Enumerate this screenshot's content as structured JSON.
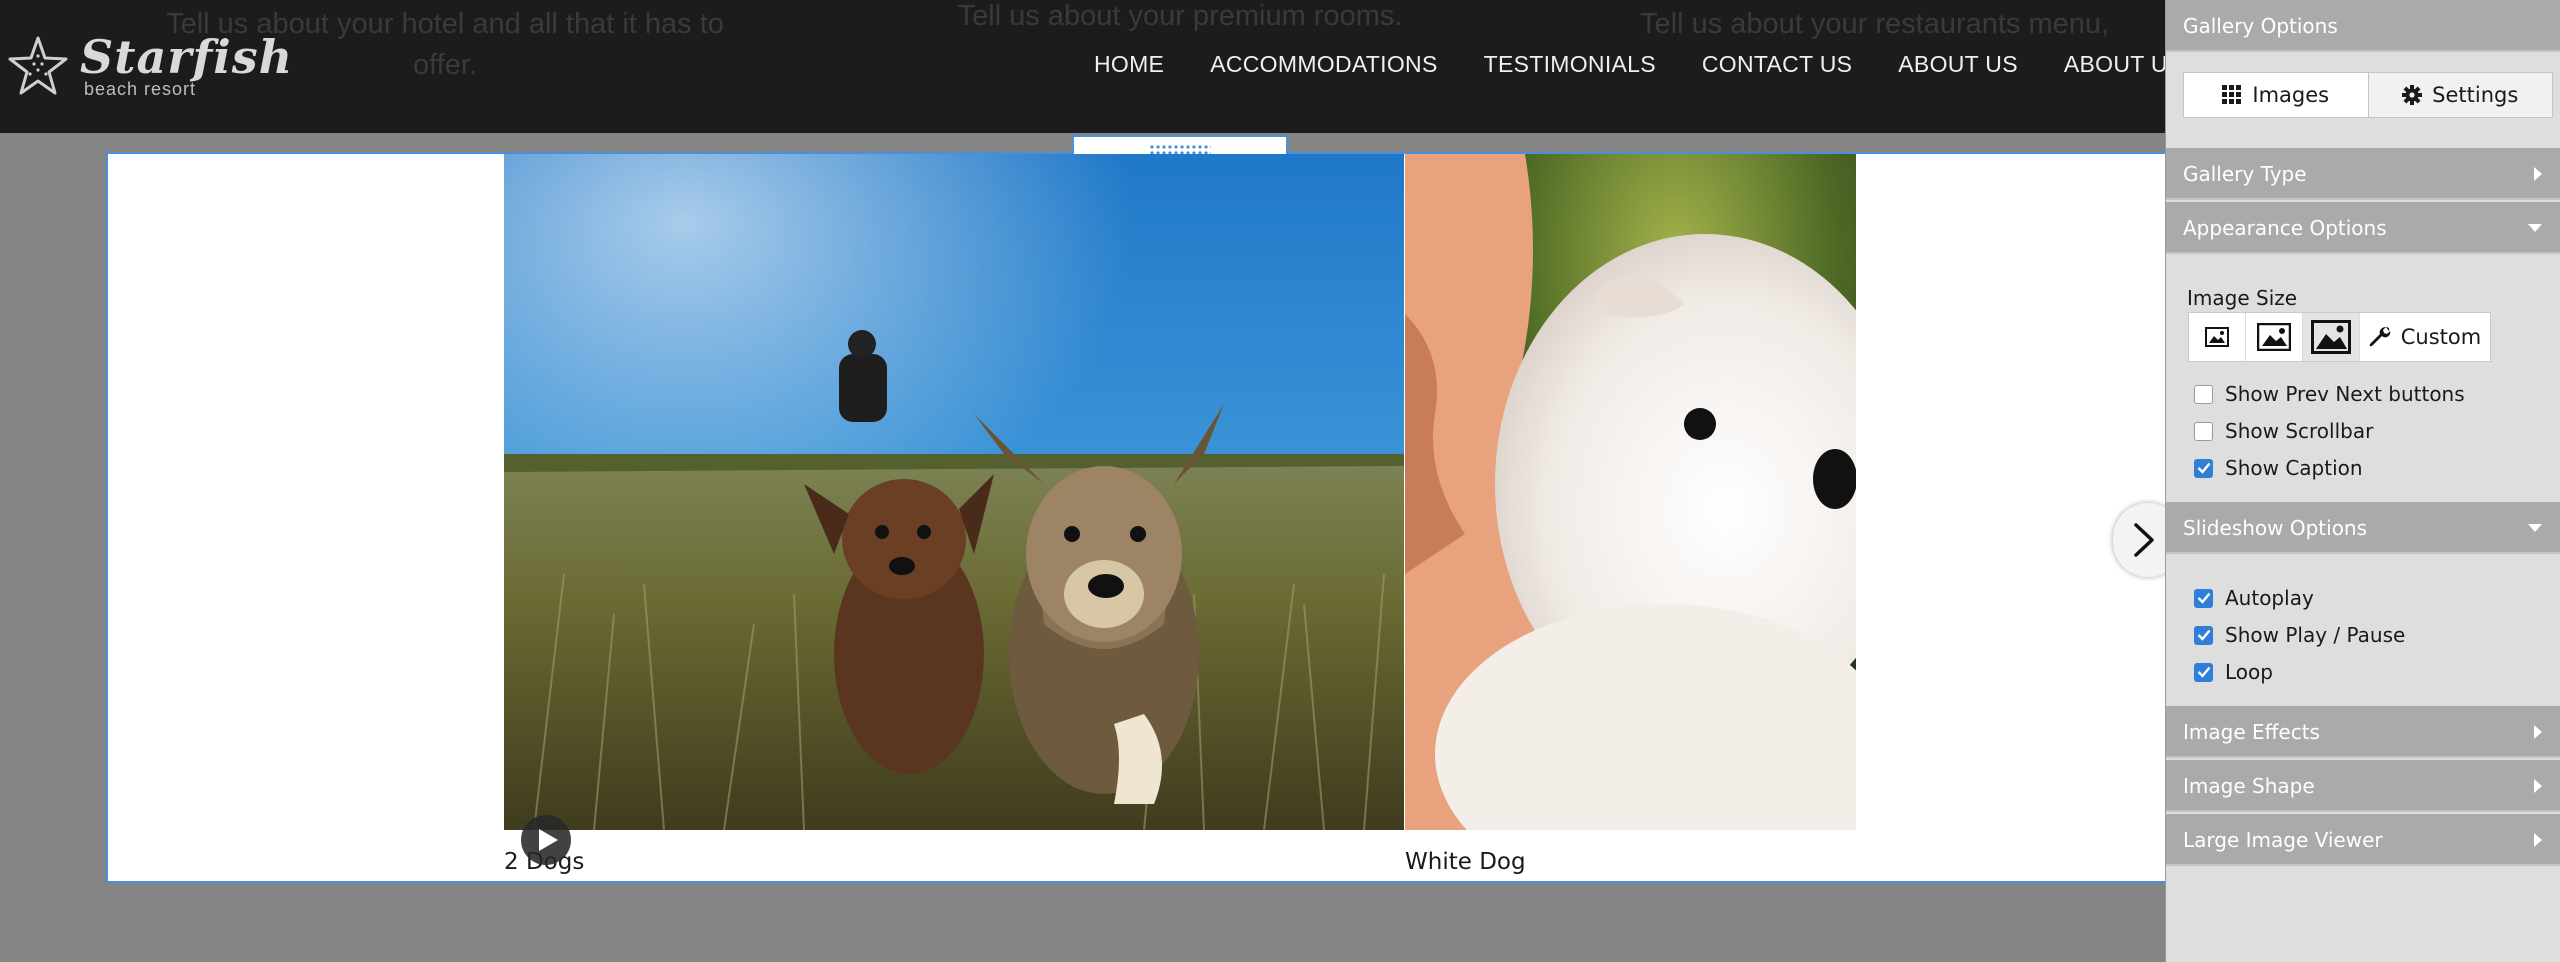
{
  "site": {
    "logo_name": "Starfish",
    "logo_tagline": "beach resort",
    "ghost_texts": [
      "Tell us about your hotel and all that it has to offer.",
      "Tell us about your premium rooms.",
      "Tell us about your restaurants menu,"
    ],
    "nav": [
      "HOME",
      "ACCOMMODATIONS",
      "TESTIMONIALS",
      "CONTACT US",
      "ABOUT US",
      "ABOUT US"
    ]
  },
  "gallery": {
    "slides": [
      {
        "caption": "2 Dogs"
      },
      {
        "caption": "White Dog"
      }
    ],
    "play_icon": "play-icon",
    "next_icon": "chevron-right-icon",
    "drag_icon": "drag-handle-icon"
  },
  "panel": {
    "title": "Gallery Options",
    "tabs": {
      "images": "Images",
      "settings": "Settings"
    },
    "sections": {
      "gallery_type": "Gallery Type",
      "appearance": "Appearance Options",
      "slideshow": "Slideshow Options",
      "effects": "Image Effects",
      "shape": "Image Shape",
      "viewer": "Large Image Viewer"
    },
    "image_size": {
      "label": "Image Size",
      "custom": "Custom",
      "selected": "large"
    },
    "appearance_checks": [
      {
        "label": "Show Prev Next buttons",
        "checked": false
      },
      {
        "label": "Show Scrollbar",
        "checked": false
      },
      {
        "label": "Show Caption",
        "checked": true
      }
    ],
    "slideshow_checks": [
      {
        "label": "Autoplay",
        "checked": true
      },
      {
        "label": "Show Play / Pause",
        "checked": true
      },
      {
        "label": "Loop",
        "checked": true
      }
    ]
  },
  "colors": {
    "accent": "#2f7ed8",
    "selection_border": "#4a8fdc",
    "header_bg": "#1c1c1c",
    "panel_header": "#aaaaaa"
  }
}
